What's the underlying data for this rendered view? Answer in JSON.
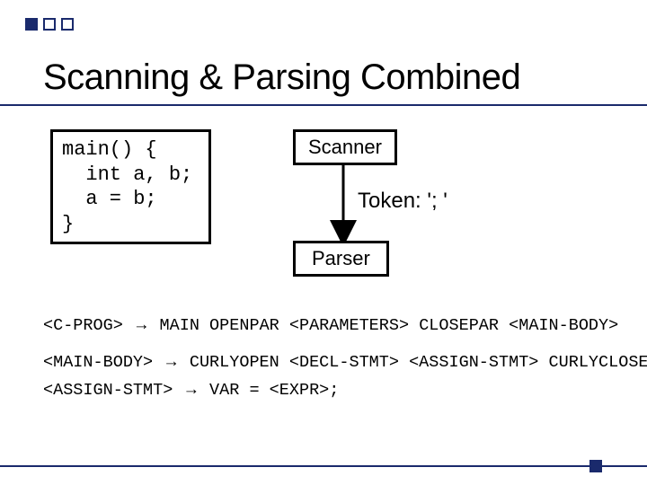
{
  "title": "Scanning & Parsing Combined",
  "code": "main() {\n  int a, b;\n  a = b;\n}",
  "scanner_label": "Scanner",
  "token_label": "Token: '; '",
  "parser_label": "Parser",
  "grammar": {
    "r1_lhs": "<C-PROG>",
    "r1_rhs": "MAIN OPENPAR <PARAMETERS> CLOSEPAR <MAIN-BODY>",
    "r2_lhs": "<MAIN-BODY>",
    "r2_rhs": "CURLYOPEN <DECL-STMT> <ASSIGN-STMT> CURLYCLOSE",
    "r3_lhs": "<ASSIGN-STMT>",
    "r3_rhs": "VAR = <EXPR>;"
  },
  "arrow_glyph": "→"
}
